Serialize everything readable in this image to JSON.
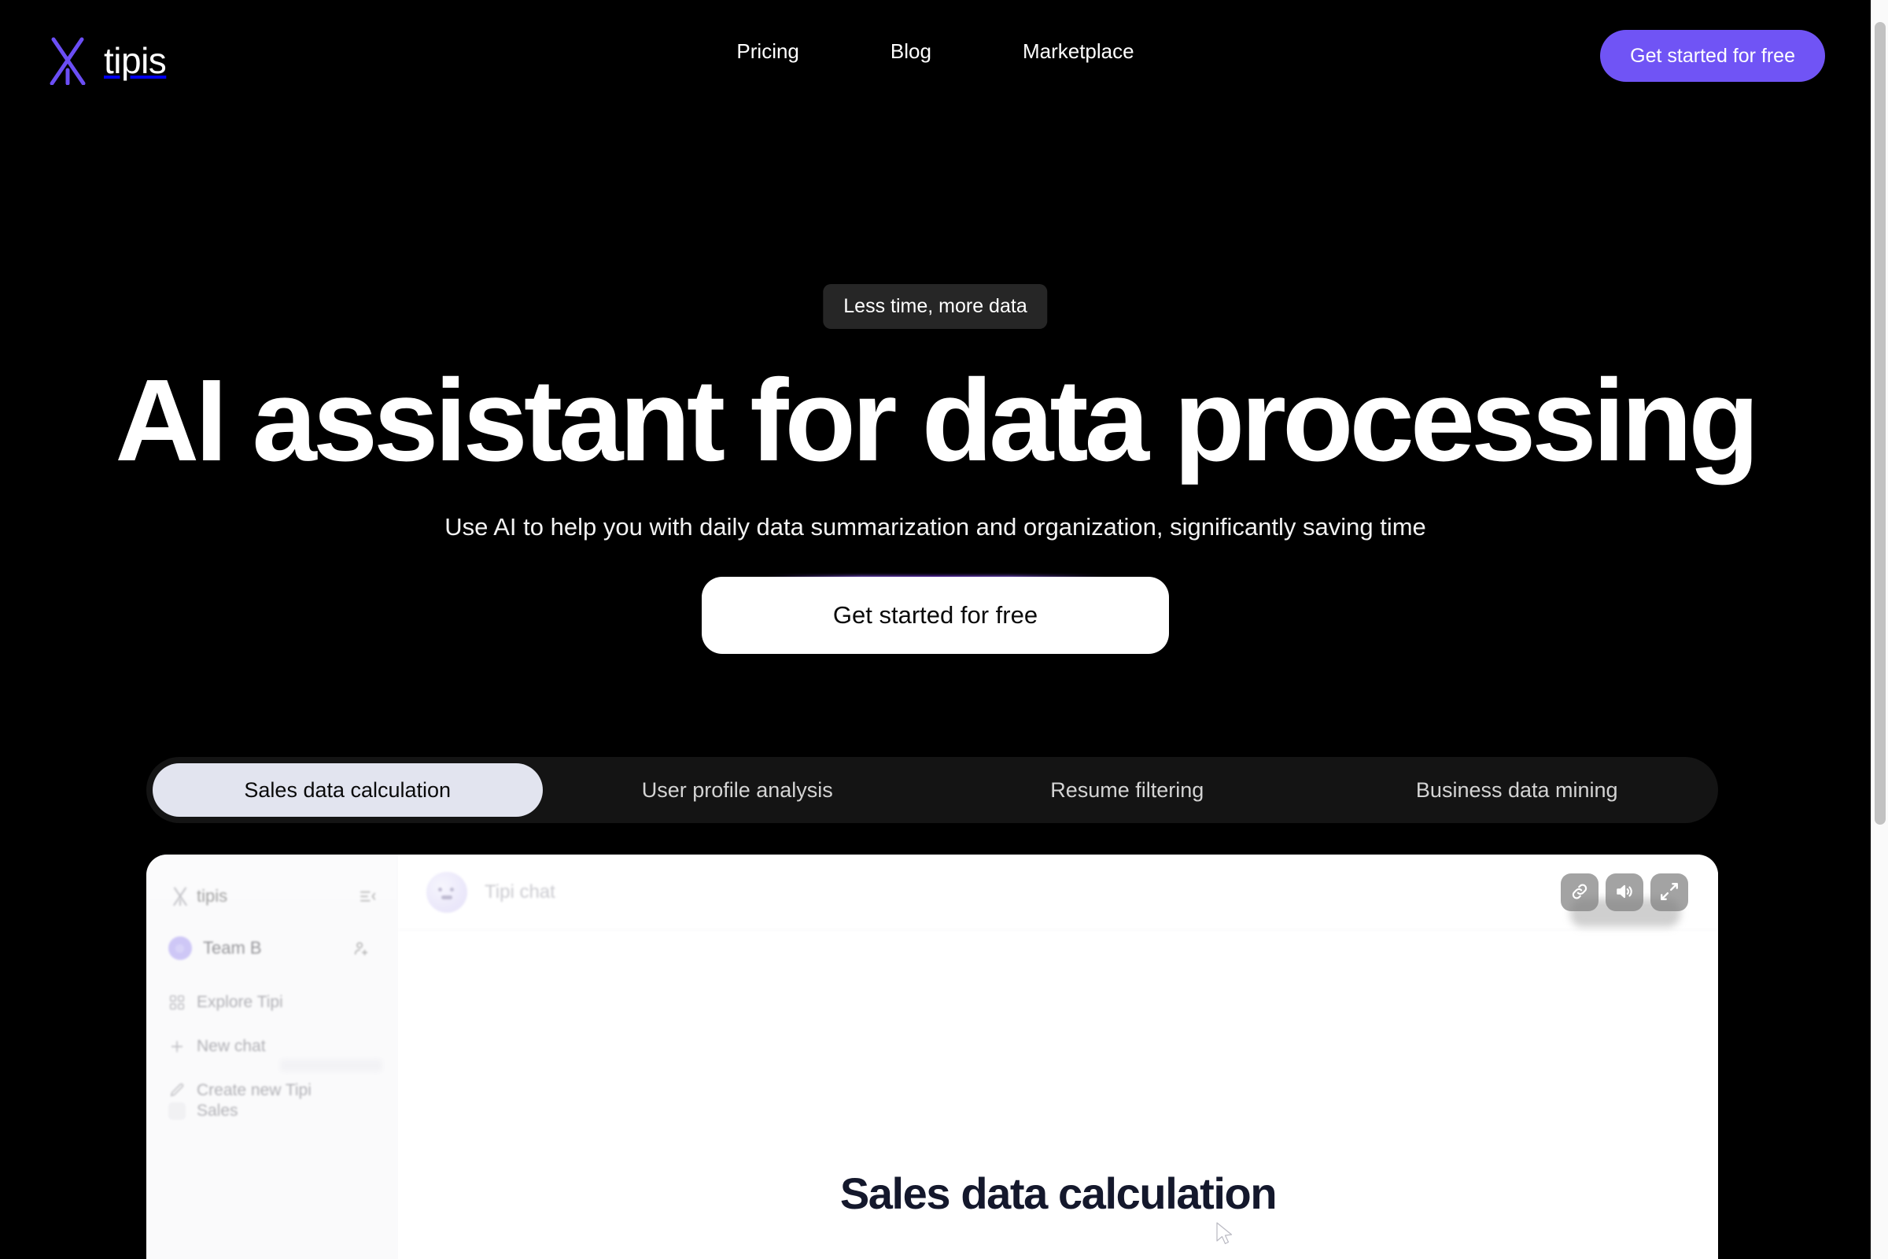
{
  "brand": {
    "name": "tipis",
    "logo_icon": "tipi-logo-icon",
    "accent_color": "#6b4ef5"
  },
  "nav": {
    "links": [
      {
        "label": "Pricing",
        "name": "nav-link-pricing"
      },
      {
        "label": "Blog",
        "name": "nav-link-blog"
      },
      {
        "label": "Marketplace",
        "name": "nav-link-marketplace"
      }
    ],
    "cta_label": "Get started for free",
    "cta_color": "#7054f5"
  },
  "hero": {
    "badge": "Less time, more data",
    "title": "AI assistant for data processing",
    "subtitle": "Use AI to help you with daily data summarization and organization, significantly saving time",
    "cta_label": "Get started for free",
    "cta_bg": "#ffffff",
    "cta_glow_color": "#7c3aed"
  },
  "tabs": {
    "active_index": 0,
    "items": [
      {
        "label": "Sales data calculation",
        "name": "tab-sales-data-calculation"
      },
      {
        "label": "User profile analysis",
        "name": "tab-user-profile-analysis"
      },
      {
        "label": "Resume filtering",
        "name": "tab-resume-filtering"
      },
      {
        "label": "Business data mining",
        "name": "tab-business-data-mining"
      }
    ],
    "active_bg": "#e2e4ef",
    "track_bg": "#141414"
  },
  "preview": {
    "sidebar": {
      "brand": "tipis",
      "collapse_icon": "sidebar-collapse-icon",
      "team": {
        "name": "Team B",
        "add_member_icon": "add-member-icon"
      },
      "items": [
        {
          "label": "Explore Tipi",
          "icon": "grid-icon",
          "name": "sidebar-item-explore-tipi"
        },
        {
          "label": "New chat",
          "icon": "plus-icon",
          "name": "sidebar-item-new-chat"
        },
        {
          "label": "Create new Tipi",
          "icon": "pencil-icon",
          "name": "sidebar-item-create-new-tipi"
        }
      ],
      "footer_item": {
        "label": "Sales",
        "name": "sidebar-item-sales"
      }
    },
    "header": {
      "title": "Tipi chat",
      "avatar": "tipi-avatar"
    },
    "actions": [
      {
        "icon": "link-icon",
        "name": "copy-link-button"
      },
      {
        "icon": "speaker-icon",
        "name": "volume-button"
      },
      {
        "icon": "expand-icon",
        "name": "fullscreen-button"
      }
    ],
    "doc_title": "Sales data calculation"
  }
}
